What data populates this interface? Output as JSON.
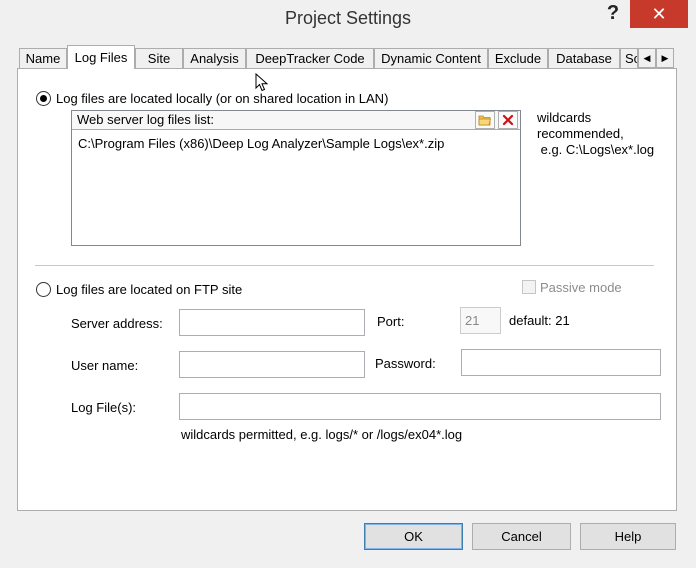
{
  "window": {
    "title": "Project Settings",
    "help_symbol": "?",
    "close_symbol": "✕"
  },
  "tabs": [
    {
      "label": "Name"
    },
    {
      "label": "Log Files"
    },
    {
      "label": "Site"
    },
    {
      "label": "Analysis"
    },
    {
      "label": "DeepTracker Code"
    },
    {
      "label": "Dynamic Content"
    },
    {
      "label": "Exclude"
    },
    {
      "label": "Database"
    },
    {
      "label": "Sc"
    }
  ],
  "tab_scroll": {
    "left": "◀",
    "right": "▶"
  },
  "local": {
    "radio_label": "Log files are located locally (or on shared location in LAN)",
    "list_header": "Web server log files list:",
    "list_items": [
      "C:\\Program Files (x86)\\Deep Log Analyzer\\Sample Logs\\ex*.zip"
    ],
    "hint_line1": "wildcards",
    "hint_line2": "recommended,",
    "hint_line3": " e.g. C:\\Logs\\ex*.log"
  },
  "ftp": {
    "radio_label": "Log files are located on FTP site",
    "passive_label": "Passive mode",
    "server_label": "Server address:",
    "server_value": "",
    "port_label": "Port:",
    "port_value": "21",
    "port_hint": "default: 21",
    "user_label": "User name:",
    "user_value": "",
    "password_label": "Password:",
    "password_value": "",
    "logfile_label": "Log File(s):",
    "logfile_value": "",
    "logfile_hint": "wildcards permitted, e.g. logs/* or /logs/ex04*.log"
  },
  "buttons": {
    "ok": "OK",
    "cancel": "Cancel",
    "help": "Help"
  },
  "colors": {
    "close_button": "#c7392b",
    "default_button_border": "#3c7fb1"
  }
}
